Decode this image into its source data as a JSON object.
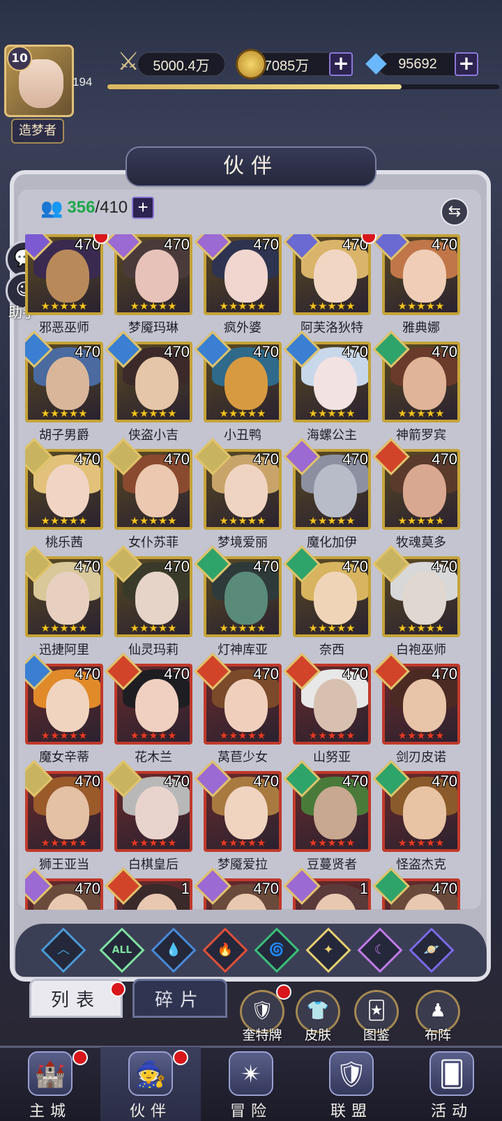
{
  "header": {
    "level": "10",
    "exp_value": "194",
    "exp_fraction": 0.75,
    "title": "造梦者",
    "power": "5000.4万",
    "gold": "7085万",
    "diamonds": "95692"
  },
  "panel": {
    "title": "伙伴",
    "count_current": "356",
    "count_total": "/410",
    "helper_label": "助手"
  },
  "cards": [
    {
      "name": "邪恶巫师",
      "level": "470",
      "frame": "gold",
      "element": "#7b5ad2",
      "dot": true,
      "skin": "#b88a5a",
      "hair": "#3a2a50"
    },
    {
      "name": "梦魇玛琳",
      "level": "470",
      "frame": "gold",
      "element": "#9b6ad2",
      "dot": false,
      "skin": "#e7c2b8",
      "hair": "#4a3a3a"
    },
    {
      "name": "疯外婆",
      "level": "470",
      "frame": "gold",
      "element": "#9b6ad2",
      "dot": false,
      "skin": "#f0d6cf",
      "hair": "#2e3450"
    },
    {
      "name": "阿芙洛狄特",
      "level": "470",
      "frame": "gold",
      "element": "#6a6ad2",
      "dot": true,
      "skin": "#f1d6c4",
      "hair": "#d9b46a"
    },
    {
      "name": "雅典娜",
      "level": "470",
      "frame": "gold",
      "element": "#6a6ad2",
      "dot": false,
      "skin": "#f0cdb7",
      "hair": "#c07648"
    },
    {
      "name": "胡子男爵",
      "level": "470",
      "frame": "gold",
      "element": "#3a7fd2",
      "dot": false,
      "skin": "#d9b69a",
      "hair": "#4a6aa0"
    },
    {
      "name": "侠盗小吉",
      "level": "470",
      "frame": "gold",
      "element": "#3a7fd2",
      "dot": false,
      "skin": "#e6c6a8",
      "hair": "#3c2a2a"
    },
    {
      "name": "小丑鸭",
      "level": "470",
      "frame": "gold",
      "element": "#3a7fd2",
      "dot": false,
      "skin": "#d89a40",
      "hair": "#2f6a8a"
    },
    {
      "name": "海螺公主",
      "level": "470",
      "frame": "gold",
      "element": "#3a7fd2",
      "dot": false,
      "skin": "#f2e2e2",
      "hair": "#c8d8ea"
    },
    {
      "name": "神箭罗宾",
      "level": "470",
      "frame": "gold",
      "element": "#2fa46a",
      "dot": false,
      "skin": "#e0b498",
      "hair": "#6a3a2a"
    },
    {
      "name": "桃乐茜",
      "level": "470",
      "frame": "gold",
      "element": "#c8b460",
      "dot": false,
      "skin": "#f1d4c4",
      "hair": "#e2c27a"
    },
    {
      "name": "女仆苏菲",
      "level": "470",
      "frame": "gold",
      "element": "#c8b460",
      "dot": false,
      "skin": "#ecc8b0",
      "hair": "#8a4a30"
    },
    {
      "name": "梦境爱丽",
      "level": "470",
      "frame": "gold",
      "element": "#c8b460",
      "dot": false,
      "skin": "#f0d4c2",
      "hair": "#c8a46a"
    },
    {
      "name": "魔化加伊",
      "level": "470",
      "frame": "gold",
      "element": "#9b6ad2",
      "dot": false,
      "skin": "#b8bcc8",
      "hair": "#8c90a0"
    },
    {
      "name": "牧魂莫多",
      "level": "470",
      "frame": "gold",
      "element": "#d2442a",
      "dot": false,
      "skin": "#d9a890",
      "hair": "#5a3a2a"
    },
    {
      "name": "迅捷阿里",
      "level": "470",
      "frame": "gold",
      "element": "#c8b460",
      "dot": false,
      "skin": "#e8d0c0",
      "hair": "#d8c89a"
    },
    {
      "name": "仙灵玛莉",
      "level": "470",
      "frame": "gold",
      "element": "#c8b460",
      "dot": false,
      "skin": "#e6d4c8",
      "hair": "#3a3a2a"
    },
    {
      "name": "灯神库亚",
      "level": "470",
      "frame": "gold",
      "element": "#2fa46a",
      "dot": false,
      "skin": "#5a8a7a",
      "hair": "#2e3a3a"
    },
    {
      "name": "奈西",
      "level": "470",
      "frame": "gold",
      "element": "#2fa46a",
      "dot": false,
      "skin": "#f0d4b8",
      "hair": "#d8b460"
    },
    {
      "name": "白袍巫师",
      "level": "470",
      "frame": "gold",
      "element": "#c8b460",
      "dot": false,
      "skin": "#e0d8d0",
      "hair": "#d8d8d8"
    },
    {
      "name": "魔女辛蒂",
      "level": "470",
      "frame": "red",
      "element": "#3a7fd2",
      "dot": false,
      "skin": "#f0d4c0",
      "hair": "#e08a2a"
    },
    {
      "name": "花木兰",
      "level": "470",
      "frame": "red",
      "element": "#d2442a",
      "dot": false,
      "skin": "#f0d0c0",
      "hair": "#1e1e22"
    },
    {
      "name": "莴苣少女",
      "level": "470",
      "frame": "red",
      "element": "#d2442a",
      "dot": false,
      "skin": "#f0d0bc",
      "hair": "#7a4a2a"
    },
    {
      "name": "山努亚",
      "level": "470",
      "frame": "red",
      "element": "#d2442a",
      "dot": false,
      "skin": "#d8c0b0",
      "hair": "#e8e8e8"
    },
    {
      "name": "剑刃皮诺",
      "level": "470",
      "frame": "red",
      "element": "#d2442a",
      "dot": false,
      "skin": "#e8c4a8",
      "hair": "#4a2a22"
    },
    {
      "name": "狮王亚当",
      "level": "470",
      "frame": "red",
      "element": "#c8b460",
      "dot": false,
      "skin": "#e4c0a4",
      "hair": "#9a5a2a"
    },
    {
      "name": "白棋皇后",
      "level": "470",
      "frame": "red",
      "element": "#c8b460",
      "dot": false,
      "skin": "#e8d4cc",
      "hair": "#b8b8b8"
    },
    {
      "name": "梦魇爱拉",
      "level": "470",
      "frame": "red",
      "element": "#9b6ad2",
      "dot": false,
      "skin": "#f0d4c0",
      "hair": "#a87a40"
    },
    {
      "name": "豆蔓贤者",
      "level": "470",
      "frame": "red",
      "element": "#2fa46a",
      "dot": false,
      "skin": "#c8a890",
      "hair": "#4a7a3a"
    },
    {
      "name": "怪盗杰克",
      "level": "470",
      "frame": "red",
      "element": "#2fa46a",
      "dot": false,
      "skin": "#e8c4a4",
      "hair": "#8a5a2a"
    },
    {
      "name": "",
      "level": "470",
      "frame": "red",
      "element": "#9b6ad2",
      "dot": false,
      "skin": "#e8c8b0",
      "hair": "#6a4a3a"
    },
    {
      "name": "",
      "level": "1",
      "frame": "red",
      "element": "#d2442a",
      "dot": false,
      "skin": "#e8c8b0",
      "hair": "#3a2a2a"
    },
    {
      "name": "",
      "level": "470",
      "frame": "red",
      "element": "#9b6ad2",
      "dot": false,
      "skin": "#e8c8b0",
      "hair": "#6a4a3a"
    },
    {
      "name": "",
      "level": "1",
      "frame": "red",
      "element": "#9b6ad2",
      "dot": false,
      "skin": "#e8c8b0",
      "hair": "#5a3a3a"
    },
    {
      "name": "",
      "level": "470",
      "frame": "red",
      "element": "#2fa46a",
      "dot": false,
      "skin": "#e8c8b0",
      "hair": "#6a4a3a"
    }
  ],
  "filters": [
    {
      "icon": "chevron-up-icon",
      "glyph": "︿",
      "color": "#4a9ad8"
    },
    {
      "icon": "all-icon",
      "glyph": "ALL",
      "color": "#7ee0a0"
    },
    {
      "icon": "water-drop-icon",
      "glyph": "💧",
      "color": "#4a8ad8"
    },
    {
      "icon": "fire-icon",
      "glyph": "🔥",
      "color": "#e0503a"
    },
    {
      "icon": "wind-icon",
      "glyph": "🌀",
      "color": "#3ac07a"
    },
    {
      "icon": "light-icon",
      "glyph": "✦",
      "color": "#e8d070"
    },
    {
      "icon": "moon-icon",
      "glyph": "☾",
      "color": "#c07ae8"
    },
    {
      "icon": "planet-icon",
      "glyph": "🪐",
      "color": "#7a6ae8"
    }
  ],
  "tabs": {
    "list": "列表",
    "fragments": "碎片"
  },
  "subnav": [
    {
      "label": "奎特牌",
      "glyph": "🛡",
      "dot": true
    },
    {
      "label": "皮肤",
      "glyph": "👕",
      "dot": false
    },
    {
      "label": "图鉴",
      "glyph": "🃏",
      "dot": false
    },
    {
      "label": "布阵",
      "glyph": "♟",
      "dot": false
    }
  ],
  "nav": [
    {
      "label": "主城",
      "glyph": "🏰",
      "dot": true
    },
    {
      "label": "伙伴",
      "glyph": "🧙",
      "dot": true
    },
    {
      "label": "冒险",
      "glyph": "✴",
      "dot": false
    },
    {
      "label": "联盟",
      "glyph": "🛡",
      "dot": false
    },
    {
      "label": "活动",
      "glyph": "🂠",
      "dot": false
    }
  ],
  "star": "★"
}
